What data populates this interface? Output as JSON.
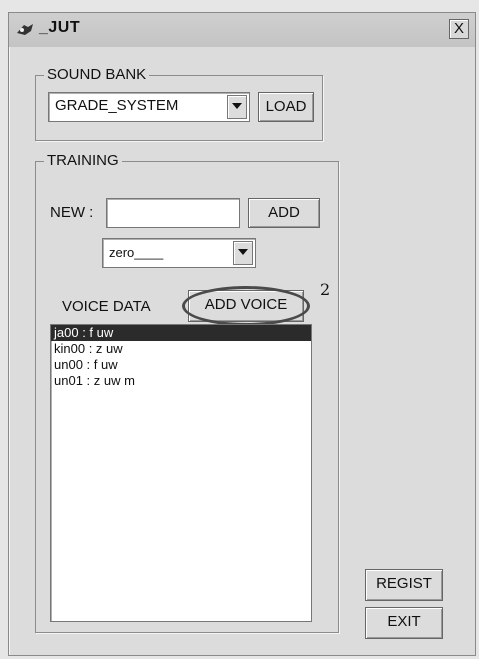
{
  "window": {
    "title": "_JUT",
    "close_label": "X"
  },
  "sound_bank": {
    "legend": "SOUND BANK",
    "combo_value": "GRADE_SYSTEM",
    "load_label": "LOAD"
  },
  "training": {
    "legend": "TRAINING",
    "new_label": "NEW :",
    "new_value": "",
    "add_label": "ADD",
    "combo_value": "zero____",
    "voice_data_label": "VOICE DATA",
    "add_voice_label": "ADD VOICE",
    "annotation_number": "2",
    "voice_items": [
      {
        "text": "ja00 : f uw",
        "selected": true
      },
      {
        "text": "kin00 : z uw",
        "selected": false
      },
      {
        "text": "un00 : f uw",
        "selected": false
      },
      {
        "text": "un01 : z uw m",
        "selected": false
      }
    ]
  },
  "actions": {
    "regist_label": "REGIST",
    "exit_label": "EXIT"
  }
}
